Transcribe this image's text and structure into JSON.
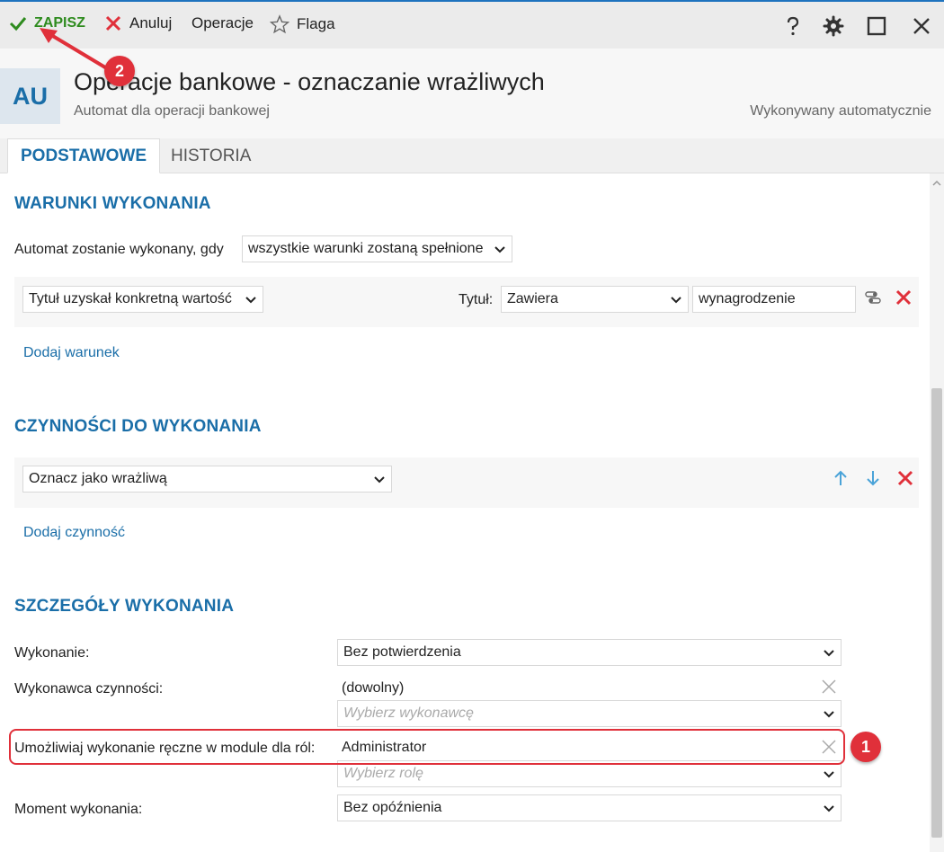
{
  "toolbar": {
    "save_label": "ZAPISZ",
    "cancel_label": "Anuluj",
    "operations_label": "Operacje",
    "flag_label": "Flaga"
  },
  "header": {
    "avatar": "AU",
    "title": "Operacje bankowe - oznaczanie wrażliwych",
    "subtitle": "Automat dla operacji bankowej",
    "execution_mode": "Wykonywany automatycznie"
  },
  "tabs": [
    {
      "label": "PODSTAWOWE"
    },
    {
      "label": "HISTORIA"
    }
  ],
  "conditions": {
    "title": "WARUNKI WYKONANIA",
    "when_label": "Automat zostanie wykonany, gdy",
    "when_value": "wszystkie warunki zostaną spełnione",
    "rows": [
      {
        "condition": "Tytuł uzyskał konkretną wartość",
        "field_label": "Tytuł:",
        "operator": "Zawiera",
        "value": "wynagrodzenie"
      }
    ],
    "add_link": "Dodaj warunek"
  },
  "actions": {
    "title": "CZYNNOŚCI DO WYKONANIA",
    "rows": [
      {
        "action": "Oznacz jako wrażliwą"
      }
    ],
    "add_link": "Dodaj czynność"
  },
  "details": {
    "title": "SZCZEGÓŁY WYKONANIA",
    "execution_label": "Wykonanie:",
    "execution_value": "Bez potwierdzenia",
    "performer_label": "Wykonawca czynności:",
    "performer_value": "(dowolny)",
    "performer_placeholder": "Wybierz wykonawcę",
    "roles_label": "Umożliwiaj wykonanie ręczne w module dla ról:",
    "roles_value": "Administrator",
    "roles_placeholder": "Wybierz rolę",
    "moment_label": "Moment wykonania:",
    "moment_value": "Bez opóźnienia"
  },
  "annotations": {
    "badge_1": "1",
    "badge_2": "2"
  },
  "colors": {
    "accent": "#1a6ea8",
    "save_green": "#2e8b1e",
    "delete_red": "#e0303a",
    "arrow_blue": "#4aa3d8"
  }
}
